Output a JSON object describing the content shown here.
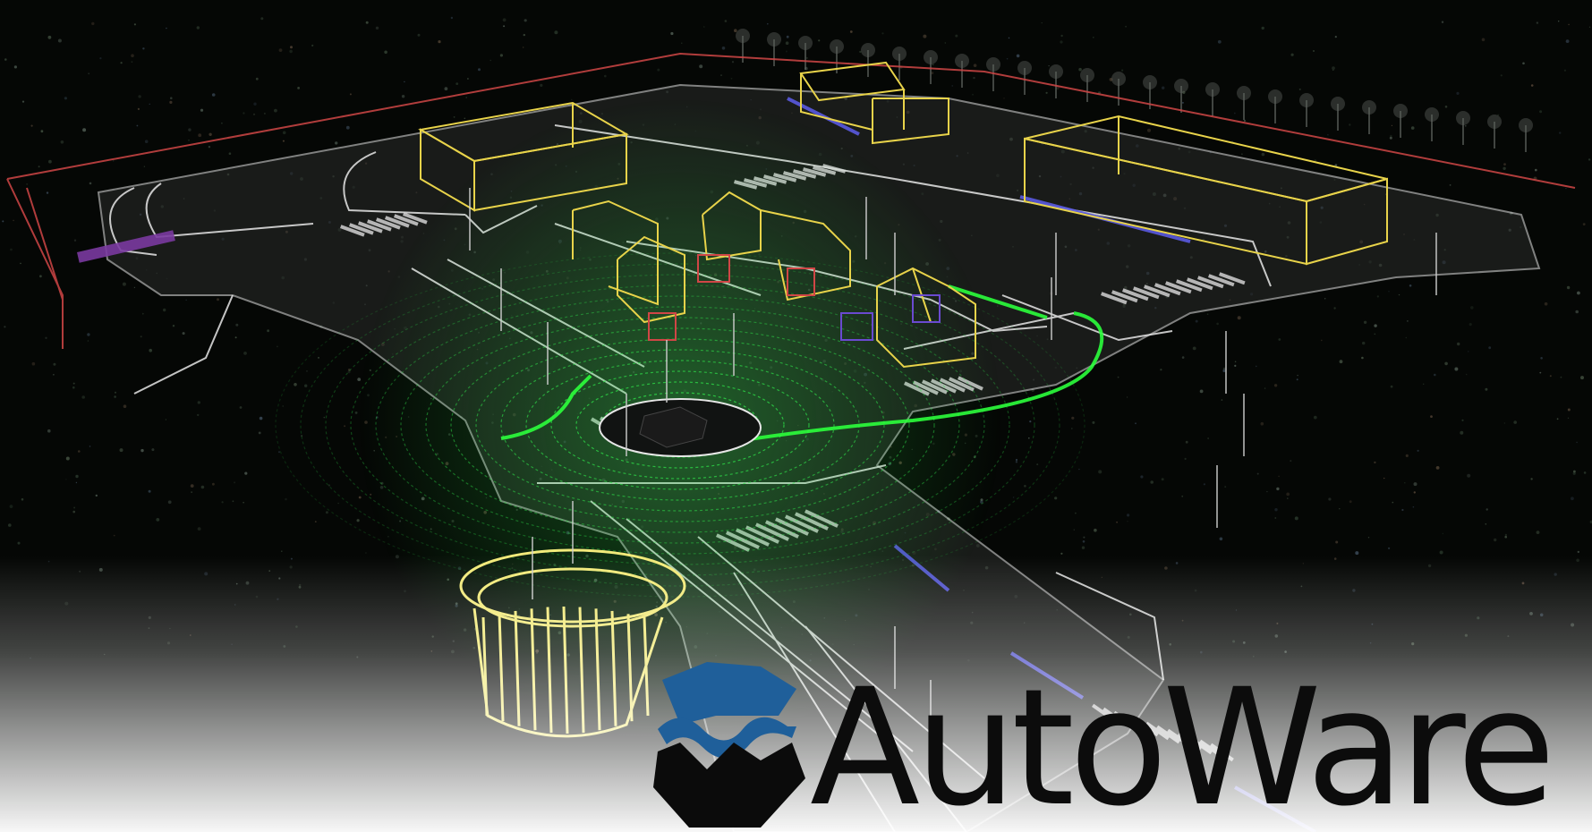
{
  "logo": {
    "wordmark": "AutoWare",
    "mark_colors": {
      "top": "#1f5f9a",
      "wave": "#1f5f9a",
      "bottom": "#0b0b0b"
    }
  },
  "palette": {
    "background": "#050705",
    "road_line": "#e6e6e6",
    "building_outline": "#e8d34a",
    "boundary": "#d04646",
    "lidar_ring": "#2fe04a",
    "route_path": "#2cff3c",
    "stop_line": "#5a5ae0",
    "fade_bottom": "#ffffff"
  }
}
